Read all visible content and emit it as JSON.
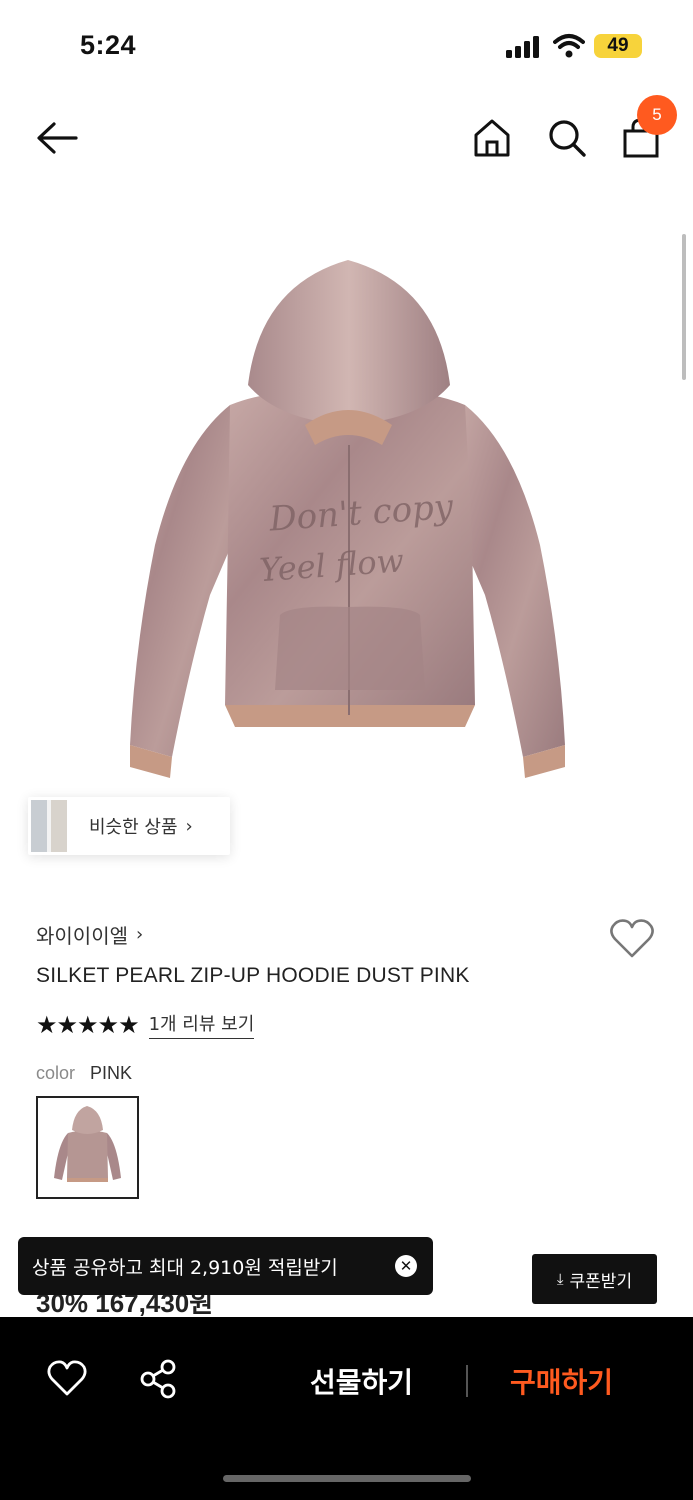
{
  "status": {
    "time": "5:24",
    "battery": "49"
  },
  "nav": {
    "cart_count": "5"
  },
  "similar": {
    "label": "비슷한 상품"
  },
  "product": {
    "brand": "와이이이엘",
    "title": "SILKET PEARL ZIP-UP HOODIE DUST PINK",
    "rating_stars": "★★★★★",
    "review_link": "1개 리뷰 보기",
    "color_label": "color",
    "color_value": "PINK",
    "price_partial": "30% 167,430원"
  },
  "toast": {
    "message": "상품 공유하고 최대 2,910원 적립받기",
    "close_symbol": "✕"
  },
  "coupon": {
    "label": "쿠폰받기"
  },
  "bottom_bar": {
    "gift_label": "선물하기",
    "buy_label": "구매하기"
  },
  "colors": {
    "accent": "#ff5a1f",
    "product_pink": "#b59693",
    "rib": "#c69a85",
    "battery": "#f7d33b"
  },
  "icons": [
    "back-arrow-icon",
    "home-icon",
    "search-icon",
    "shopping-bag-icon",
    "heart-icon",
    "share-icon",
    "chevron-right-icon",
    "download-icon",
    "close-icon",
    "signal-icon",
    "wifi-icon"
  ]
}
